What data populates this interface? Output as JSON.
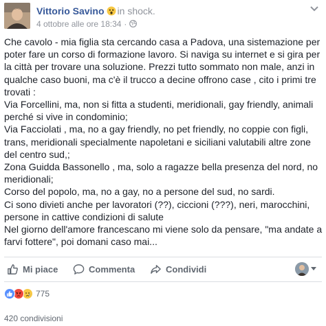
{
  "header": {
    "author": "Vittorio Savino",
    "feeling": "in shock.",
    "date": "4 ottobre alle ore 18:34",
    "separator": "·",
    "icons": {
      "feeling": "shocked-face-icon",
      "audience": "globe-icon",
      "menu": "chevron-down-icon"
    }
  },
  "post": {
    "text": "Che cavolo - mia figlia sta cercando casa a Padova, una sistemazione per poter fare un corso di formazione lavoro. Si naviga su internet e si gira per la città per trovare una soluzione. Prezzi tutto sommato non male, anzi in qualche caso buoni, ma c'è il trucco a decine offrono case , cito i primi tre trovati :\nVia Forcellini, ma, non si fitta a studenti, meridionali, gay friendly, animali perché si vive in condominio;\nVia Facciolati , ma, no a gay friendly, no pet friendly, no coppie con figli, trans, meridionali specialmente napoletani e siciliani valutabili altre zone del centro sud,;\nZona Guidda Bassonello , ma, solo a ragazze bella presenza del nord, no meridionali;\nCorso del popolo, ma, no a gay, no a persone del sud, no sardi.\nCi sono divieti anche per lavoratori (??), ciccioni (???), neri, marocchini, persone in cattive condizioni di salute\nNel giorno dell'amore francescano mi viene solo da pensare, \"ma andate a farvi fottere\", poi domani caso mai..."
  },
  "actions": {
    "like": "Mi piace",
    "comment": "Commenta",
    "share": "Condividi",
    "icons": [
      "thumbs-up-icon",
      "comment-icon",
      "share-arrow-icon",
      "profile-switch-icon"
    ]
  },
  "reactions": {
    "types": [
      "like",
      "angry",
      "sad"
    ],
    "count": "775"
  },
  "shares": "420 condivisioni",
  "colors": {
    "link": "#365899",
    "meta": "#90949c",
    "action": "#606770",
    "like": "#5890ff",
    "angry": "#f0483c",
    "sad": "#f7c844"
  }
}
